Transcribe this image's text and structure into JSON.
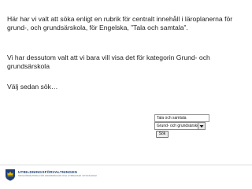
{
  "slide": {
    "paragraphs": [
      "Här har vi valt att söka enligt en rubrik för centralt innehåll i läroplanerna för grund-, och grundsärskola, för Engelska, ”Tala och samtala”.",
      "Vi har dessutom valt att vi bara vill visa det för kategorin Grund- och grundsärskola",
      "Välj sedan sök…"
    ]
  },
  "search_form": {
    "query_value": "Tala och samtala",
    "category_selected": "Grund- och grundsärskola",
    "search_button_label": "Sök"
  },
  "footer": {
    "org_name": "UTBILDNINGSFÖRVALTNINGEN",
    "org_tagline": "SKOLFÖRVALTNING FÖR GRUNDSKOLOR OCH GYMNASIUM I STOCKHOLM",
    "logo_icon": "stockholm-crown-emblem-icon",
    "brand_color": "#1c3f77",
    "emblem_gold": "#e8b800"
  }
}
